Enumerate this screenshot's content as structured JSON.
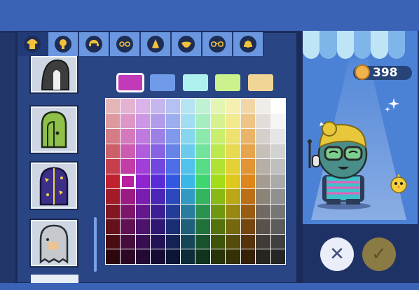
{
  "coins": "398",
  "tabs": [
    {
      "icon": "shirt-icon"
    },
    {
      "icon": "head-icon"
    },
    {
      "icon": "hair-icon"
    },
    {
      "icon": "eyes-icon"
    },
    {
      "icon": "nose-icon"
    },
    {
      "icon": "mouth-icon"
    },
    {
      "icon": "glasses-icon"
    },
    {
      "icon": "hat-icon"
    }
  ],
  "items": [
    {
      "icon": "hood-black-icon"
    },
    {
      "icon": "hood-green-icon"
    },
    {
      "icon": "hood-wizard-icon"
    },
    {
      "icon": "hood-ghost-icon"
    }
  ],
  "recent_colors": [
    "#c23ab8",
    "#6e9ae8",
    "#aef0ee",
    "#ccf28e",
    "#f0d596"
  ],
  "palette": {
    "selected_row": 5,
    "selected_col": 1,
    "rows": [
      [
        "#e3b5b7",
        "#e5b3d2",
        "#d9b3ea",
        "#c6b6ee",
        "#b5c1f2",
        "#b6e3f4",
        "#bff2d2",
        "#e2f6b2",
        "#f5f0b0",
        "#f2d6a6",
        "#f0ece8",
        "#ffffff"
      ],
      [
        "#dc9a9e",
        "#de96c6",
        "#cc97e4",
        "#b19cea",
        "#9caeef",
        "#a1def2",
        "#a6eec0",
        "#d6f28f",
        "#f1ea8f",
        "#eec587",
        "#e2ddd8",
        "#f5f5f5"
      ],
      [
        "#d47d84",
        "#d47abc",
        "#bf7ae0",
        "#9d80e6",
        "#8199ec",
        "#86d6f0",
        "#8ce9ad",
        "#caee6e",
        "#ede270",
        "#eab56a",
        "#d6d0ca",
        "#e6e6e6"
      ],
      [
        "#cc5f68",
        "#cc5caf",
        "#b05ddb",
        "#8762e2",
        "#6683e8",
        "#6ccbed",
        "#72e39a",
        "#bde950",
        "#e9d952",
        "#e6a54d",
        "#c7c0b9",
        "#d2d2d2"
      ],
      [
        "#c6404c",
        "#c23ea6",
        "#a23fd6",
        "#7147de",
        "#4d6ee4",
        "#53c2ea",
        "#58dc85",
        "#b0e234",
        "#e4d037",
        "#e29534",
        "#b7afa6",
        "#bfbfbf"
      ],
      [
        "#c0212e",
        "#b8209c",
        "#9124d0",
        "#5a2cd8",
        "#3358df",
        "#3ab7e6",
        "#3fd672",
        "#a3dc18",
        "#dfc71d",
        "#de861b",
        "#a59b90",
        "#aaaaaa"
      ],
      [
        "#a21b27",
        "#9a1b83",
        "#7a1eaf",
        "#4b25b6",
        "#2b49bc",
        "#319ac2",
        "#35b45f",
        "#89b914",
        "#bba718",
        "#bb7017",
        "#8c8379",
        "#909090"
      ],
      [
        "#841621",
        "#7d166b",
        "#63188e",
        "#3d1e94",
        "#223c98",
        "#287d9e",
        "#2a924e",
        "#6f9710",
        "#988813",
        "#985c13",
        "#726a62",
        "#767676"
      ],
      [
        "#66111a",
        "#601152",
        "#4c136d",
        "#2f1772",
        "#1a2e74",
        "#1f5f79",
        "#20713c",
        "#55730c",
        "#75680f",
        "#75470f",
        "#59524b",
        "#5c5c5c"
      ],
      [
        "#4a0c13",
        "#460c3c",
        "#370e50",
        "#221153",
        "#132155",
        "#164558",
        "#17522c",
        "#3e5409",
        "#554b0b",
        "#55330b",
        "#403b36",
        "#404040"
      ],
      [
        "#2e070c",
        "#2c0826",
        "#230933",
        "#150b35",
        "#0c1535",
        "#0e2c38",
        "#0f341c",
        "#273506",
        "#363007",
        "#362007",
        "#282521",
        "#262626"
      ]
    ]
  },
  "buttons": {
    "cancel_symbol": "✕",
    "confirm_symbol": "✓"
  }
}
